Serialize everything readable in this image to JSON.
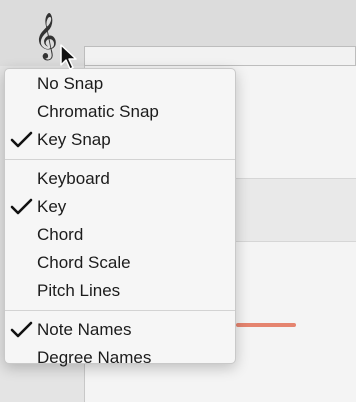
{
  "toolbar": {
    "clef_symbol": "𝄞",
    "clef_icon": "treble-clef-icon"
  },
  "menu": {
    "snap_items": [
      {
        "label": "No Snap",
        "checked": false
      },
      {
        "label": "Chromatic Snap",
        "checked": false
      },
      {
        "label": "Key Snap",
        "checked": true
      }
    ],
    "display_items": [
      {
        "label": "Keyboard",
        "checked": false
      },
      {
        "label": "Key",
        "checked": true
      },
      {
        "label": "Chord",
        "checked": false
      },
      {
        "label": "Chord Scale",
        "checked": false
      },
      {
        "label": "Pitch Lines",
        "checked": false
      }
    ],
    "name_items": [
      {
        "label": "Note Names",
        "checked": true
      },
      {
        "label": "Degree Names",
        "checked": false
      }
    ]
  },
  "colors": {
    "note_bar": "#e5846f",
    "menu_background": "#f6f6f6"
  }
}
